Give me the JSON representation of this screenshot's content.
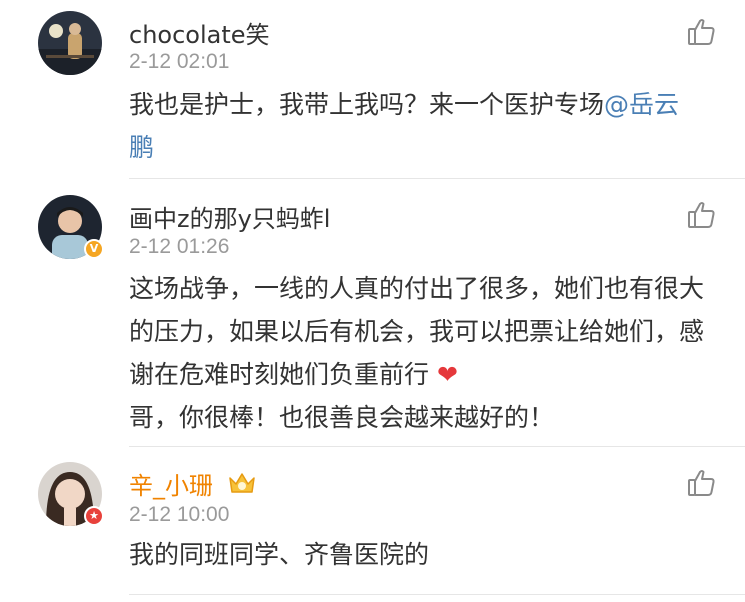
{
  "comments": [
    {
      "username": "chocolate笑",
      "timestamp": "2-12 02:01",
      "text_before": "我也是护士，我带上我吗？来一个医护专场",
      "mention": "@岳云鹏"
    },
    {
      "username": "画中z的那y只蚂蚱l",
      "timestamp": "2-12 01:26",
      "badge": "V",
      "text_before": "这场战争，一线的人真的付出了很多，她们也有很大的压力，如果以后有机会，我可以把票让给她们，感谢在危难时刻她们负重前行",
      "emoji": "❤",
      "text_after": "哥，你很棒！也很善良会越来越好的！"
    },
    {
      "username": "辛_小珊",
      "timestamp": "2-12 10:00",
      "badge": "★",
      "text_before": "我的同班同学、齐鲁医院的"
    }
  ],
  "colors": {
    "username": "#333333",
    "username_highlight": "#f08300",
    "timestamp": "#9a9a9a",
    "mention": "#4a7fb5",
    "heart": "#e5383b"
  },
  "icons": [
    "thumbs-up-icon",
    "crown-icon",
    "verified-badge-icon"
  ]
}
